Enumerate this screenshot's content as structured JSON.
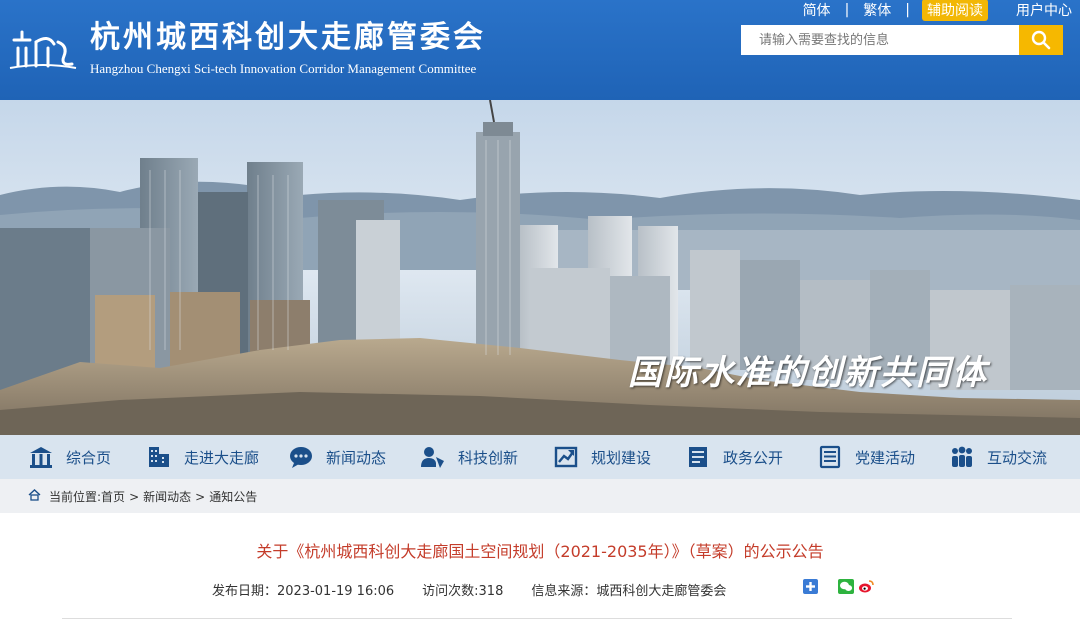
{
  "header": {
    "title": "杭州城西科创大走廊管委会",
    "subtitle": "Hangzhou Chengxi Sci-tech Innovation Corridor Management Committee",
    "top_links": {
      "simplified": "简体",
      "traditional": "繁体",
      "assist": "辅助阅读",
      "user_center": "用户中心"
    },
    "search": {
      "placeholder": "请输入需要查找的信息",
      "icon": "search-icon"
    },
    "accent": "#f6b800",
    "bg": "#1f63b6"
  },
  "banner": {
    "slogan": "国际水准的创新共同体"
  },
  "nav": {
    "items": [
      {
        "label": "综合页",
        "icon": "home-icon"
      },
      {
        "label": "走进大走廊",
        "icon": "building-icon"
      },
      {
        "label": "新闻动态",
        "icon": "chat-icon"
      },
      {
        "label": "科技创新",
        "icon": "innovation-icon"
      },
      {
        "label": "规划建设",
        "icon": "planning-icon"
      },
      {
        "label": "政务公开",
        "icon": "document-icon"
      },
      {
        "label": "党建活动",
        "icon": "list-icon"
      },
      {
        "label": "互动交流",
        "icon": "people-icon"
      }
    ]
  },
  "breadcrumb": {
    "prefix": "当前位置:",
    "items": [
      "首页",
      "新闻动态",
      "通知公告"
    ],
    "separator": ">"
  },
  "article": {
    "title": "关于《杭州城西科创大走廊国土空间规划（2021-2035年）》（草案）的公示公告",
    "publish_date": "发布日期：2023-01-19 16:06",
    "visits": "访问次数:318",
    "source": "信息来源：城西科创大走廊管委会"
  }
}
